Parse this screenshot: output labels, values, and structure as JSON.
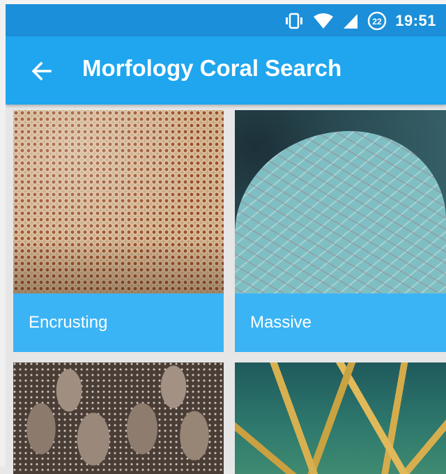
{
  "status_bar": {
    "time": "19:51",
    "notification_badge": "22",
    "icons": [
      "vibrate-icon",
      "wifi-icon",
      "signal-icon",
      "notification-badge-icon"
    ]
  },
  "app_bar": {
    "back_icon": "arrow-left-icon",
    "title": "Morfology Coral Search"
  },
  "grid": {
    "items": [
      {
        "label": "Encrusting"
      },
      {
        "label": "Massive"
      },
      {
        "label": ""
      },
      {
        "label": ""
      }
    ]
  },
  "colors": {
    "status_bar": "#1b8fd9",
    "app_bar": "#1fa6ee",
    "label_bar": "#3bb4f5",
    "text": "#ffffff"
  }
}
